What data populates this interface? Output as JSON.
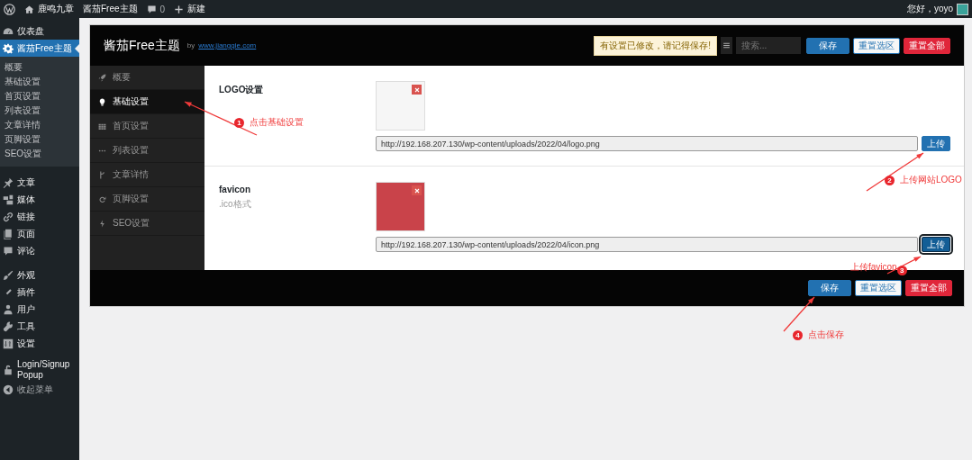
{
  "admin_bar": {
    "site_name": "鹿鸣九章",
    "theme_link": "酱茄Free主题",
    "comments": "0",
    "new_label": "新建",
    "greeting": "您好，yoyo"
  },
  "admin_menu": [
    {
      "items": [
        {
          "label": "仪表盘",
          "selected": false
        },
        {
          "label": "酱茄Free主题",
          "selected": true,
          "children": [
            {
              "label": "概要",
              "selected": false
            },
            {
              "label": "基础设置",
              "selected": false
            },
            {
              "label": "首页设置",
              "selected": false
            },
            {
              "label": "列表设置",
              "selected": false
            },
            {
              "label": "文章详情",
              "selected": false
            },
            {
              "label": "页脚设置",
              "selected": false
            },
            {
              "label": "SEO设置",
              "selected": false
            }
          ]
        }
      ]
    },
    {
      "items": [
        {
          "label": "文章",
          "selected": false
        },
        {
          "label": "媒体",
          "selected": false
        },
        {
          "label": "链接",
          "selected": false
        },
        {
          "label": "页面",
          "selected": false
        },
        {
          "label": "评论",
          "selected": false
        }
      ]
    },
    {
      "items": [
        {
          "label": "外观",
          "selected": false
        },
        {
          "label": "插件",
          "selected": false
        },
        {
          "label": "用户",
          "selected": false
        },
        {
          "label": "工具",
          "selected": false
        },
        {
          "label": "设置",
          "selected": false
        }
      ]
    },
    {
      "items": [
        {
          "label": "Login/Signup Popup",
          "selected": false
        },
        {
          "label": "收起菜单",
          "selected": false
        }
      ]
    }
  ],
  "panel": {
    "title": "酱茄Free主题",
    "by": "by",
    "site_link": "www.jiangqie.com",
    "notice": "有设置已修改，请记得保存!",
    "search": {
      "placeholder": "搜索..."
    },
    "header_buttons": [
      {
        "label": "保存",
        "kind": "primary"
      },
      {
        "label": "重置选区",
        "kind": "secondary"
      },
      {
        "label": "重置全部",
        "kind": "danger"
      }
    ],
    "nav": [
      {
        "label": "概要",
        "selected": false
      },
      {
        "label": "基础设置",
        "selected": true
      },
      {
        "label": "首页设置",
        "selected": false
      },
      {
        "label": "列表设置",
        "selected": false
      },
      {
        "label": "文章详情",
        "selected": false
      },
      {
        "label": "页脚设置",
        "selected": false
      },
      {
        "label": "SEO设置",
        "selected": false
      }
    ],
    "fields": [
      {
        "label": "LOGO设置",
        "url": "http://192.168.207.130/wp-content/uploads/2022/04/logo.png",
        "upload": "上传",
        "focused": false
      },
      {
        "label": "favicon",
        "description": ".ico格式",
        "url": "http://192.168.207.130/wp-content/uploads/2022/04/icon.png",
        "upload": "上传",
        "focused": true
      }
    ],
    "footer_buttons": [
      {
        "label": "保存",
        "kind": "primary"
      },
      {
        "label": "重置选区",
        "kind": "secondary"
      },
      {
        "label": "重置全部",
        "kind": "danger"
      }
    ]
  },
  "annotations": [
    {
      "number": "1",
      "text": "点击基础设置"
    },
    {
      "number": "2",
      "text": "上传网站LOGO"
    },
    {
      "number": "3",
      "text": "上传favicon"
    },
    {
      "number": "4",
      "text": "点击保存"
    }
  ]
}
